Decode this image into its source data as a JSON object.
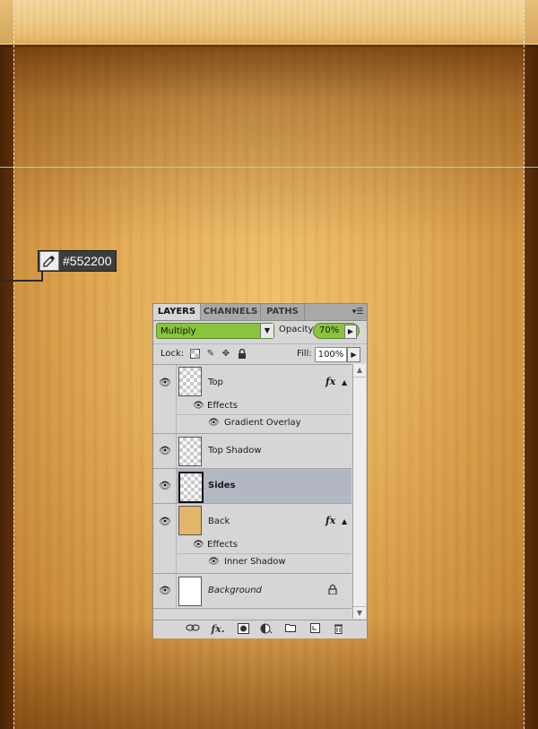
{
  "canvas": {
    "sampled_color_label": "#552200",
    "sample_icon": "eyedropper-icon",
    "colors": {
      "dark_wood": "#552200",
      "panel_accent_green": "#88c43d",
      "selected_row": "#b3b7c4"
    }
  },
  "layers_panel": {
    "tabs": [
      {
        "label": "LAYERS",
        "active": true
      },
      {
        "label": "CHANNELS",
        "active": false
      },
      {
        "label": "PATHS",
        "active": false
      }
    ],
    "menu_icon": "panel-menu-icon",
    "blend_mode": "Multiply",
    "opacity_label": "Opacity:",
    "opacity_value": "70%",
    "lock_label": "Lock:",
    "lock_icons": [
      "lock-transparency-icon",
      "lock-image-icon",
      "lock-position-icon",
      "lock-all-icon"
    ],
    "fill_label": "Fill:",
    "fill_value": "100%",
    "layers": [
      {
        "name": "Top",
        "thumb": "transparent",
        "fx": "fx",
        "effects_label": "Effects",
        "effects": [
          "Gradient Overlay"
        ]
      },
      {
        "name": "Top Shadow",
        "thumb": "transparent"
      },
      {
        "name": "Sides",
        "thumb": "transparent",
        "selected": true
      },
      {
        "name": "Back",
        "thumb": "tan",
        "fx": "fx",
        "effects_label": "Effects",
        "effects": [
          "Inner Shadow"
        ]
      },
      {
        "name": "Background",
        "thumb": "white",
        "locked": true
      }
    ],
    "bottom_icons": [
      "link-layers-icon",
      "fx-icon",
      "add-mask-icon",
      "adjustment-layer-icon",
      "new-group-icon",
      "new-layer-icon",
      "delete-layer-icon"
    ],
    "bottom_fx_label": "fx."
  }
}
